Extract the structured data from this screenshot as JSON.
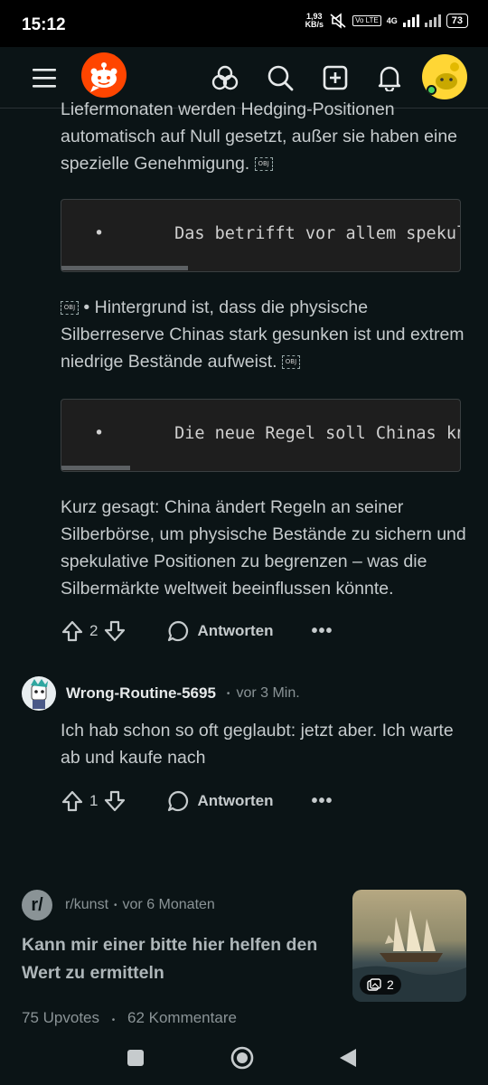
{
  "status_bar": {
    "time": "15:12",
    "speed": "1,93",
    "speed_unit": "KB/s",
    "volte": "Vo LTE",
    "network": "4G",
    "battery": "73"
  },
  "app_bar": {
    "menu_icon": "hamburger-menu-icon",
    "logo_icon": "reddit-snoo-logo",
    "explore_icon": "communities-icon",
    "search_icon": "search-icon",
    "create_icon": "add-post-icon",
    "notifications_icon": "bell-icon",
    "avatar_online": true
  },
  "comment1": {
    "para1": "Liefermonaten werden Hedging-Positionen automatisch auf Null gesetzt, außer sie haben eine spezielle Genehmigung.",
    "obj_label": "OBJ",
    "code1": "•       Das betrifft vor allem spekulative",
    "para2": "• Hintergrund ist, dass die physische Silberreserve Chinas stark gesunken ist und extrem niedrige Bestände aufweist.",
    "code2": "•       Die neue Regel soll Chinas knappe",
    "para3": "Kurz gesagt: China ändert Regeln an seiner Silberbörse, um physische Bestände zu sichern und spekulative Positionen zu begrenzen – was die Silbermärkte weltweit beeinflussen könnte.",
    "votes": "2",
    "reply_label": "Antworten",
    "more_label": "•••"
  },
  "comment2": {
    "author": "Wrong-Routine-5695",
    "time": "vor 3 Min.",
    "text": "Ich hab schon so oft geglaubt: jetzt aber. Ich warte ab und kaufe nach",
    "votes": "1",
    "reply_label": "Antworten",
    "more_label": "•••"
  },
  "related_post": {
    "subreddit": "r/kunst",
    "sub_icon_text": "r/",
    "time": "vor 6 Monaten",
    "title": "Kann mir einer bitte hier helfen den Wert zu ermitteln",
    "upvotes": "75 Upvotes",
    "comments": "62 Kommentare",
    "gallery_count": "2"
  },
  "nav_bar": {
    "recent_icon": "square-recents-icon",
    "home_icon": "circle-home-icon",
    "back_icon": "triangle-back-icon"
  }
}
